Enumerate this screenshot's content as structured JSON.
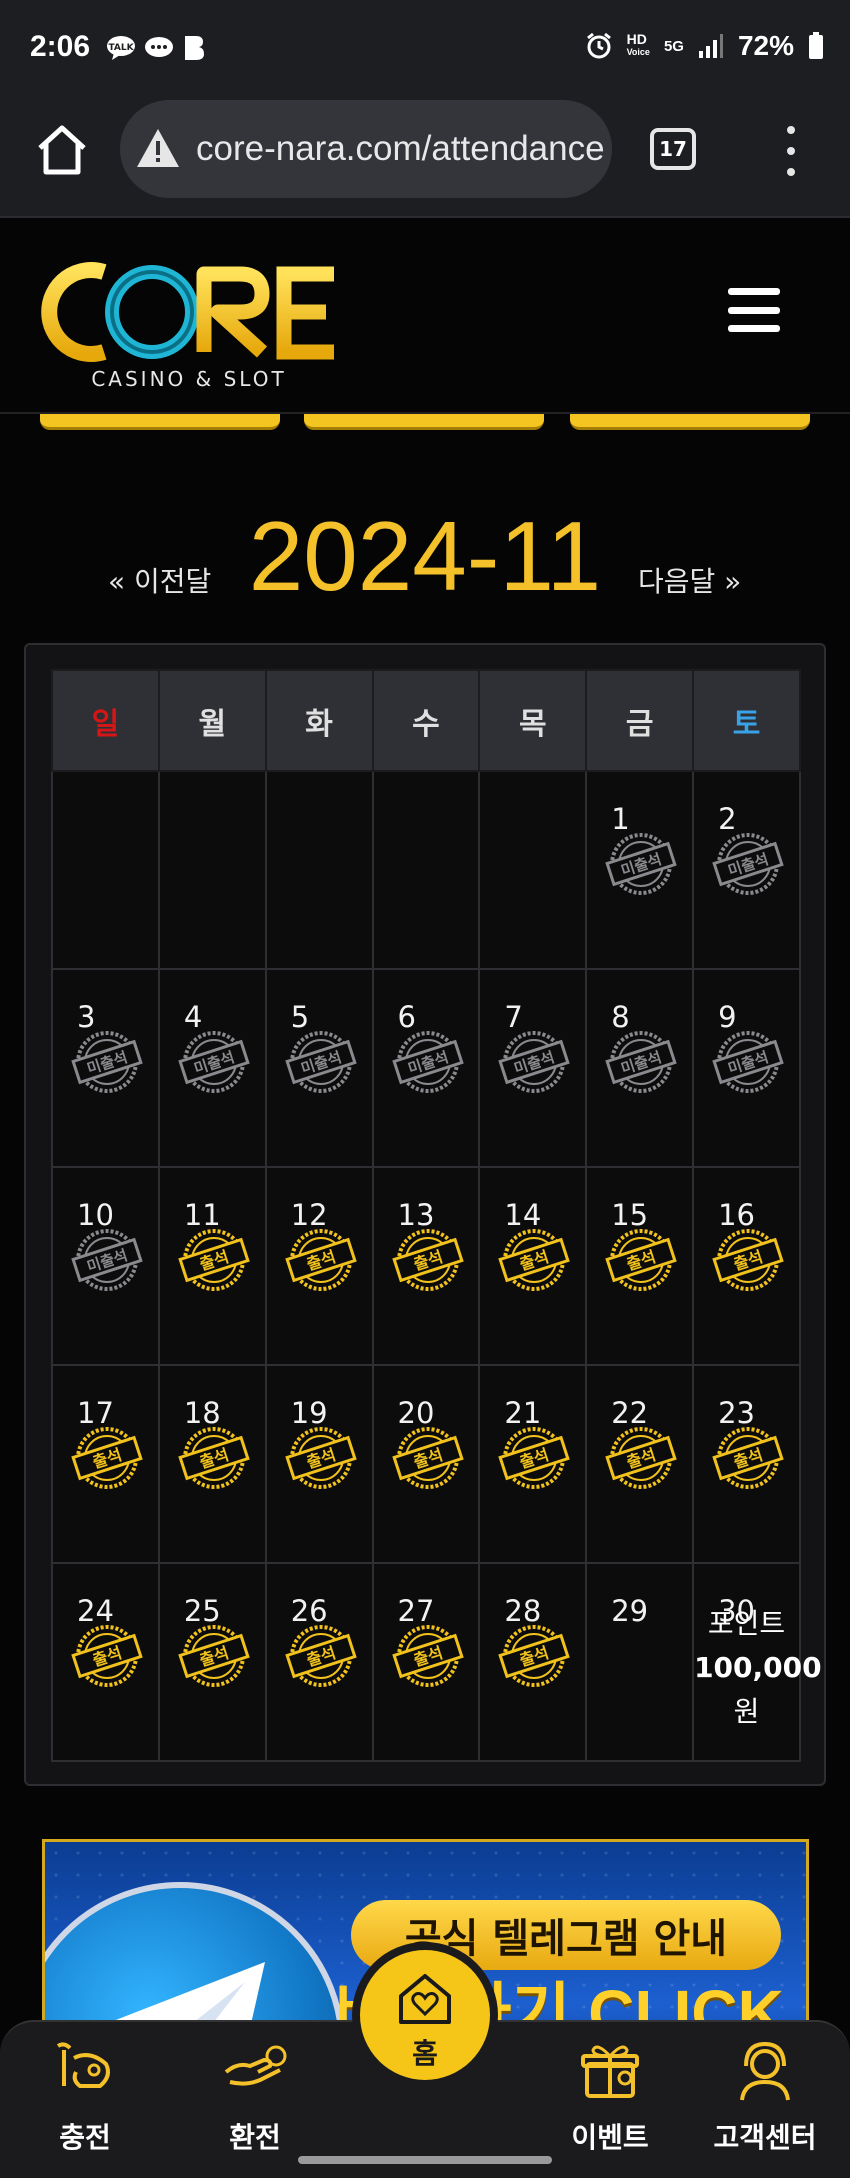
{
  "status_bar": {
    "time": "2:06",
    "icons": [
      "talk-icon",
      "chat-bubble-icon",
      "cloud-chat-icon",
      "b-app-icon",
      "alarm-icon",
      "hd-voice-icon",
      "5g-icon",
      "signal-icon"
    ],
    "hd_label": "HD",
    "voice_label": "Voice",
    "network": "5G",
    "battery": "72%"
  },
  "browser": {
    "url": "core-nara.com/attendance",
    "tab_count": "17"
  },
  "site": {
    "logo_text": "CORE",
    "logo_subtitle": "CASINO & SLOT"
  },
  "calendar": {
    "prev_label": "« 이전달",
    "next_label": "다음달 »",
    "month": "2024-11",
    "weekdays": [
      "일",
      "월",
      "화",
      "수",
      "목",
      "금",
      "토"
    ],
    "stamp_absent": "미출석",
    "stamp_present": "출석",
    "weeks": [
      [
        null,
        null,
        null,
        null,
        null,
        {
          "day": "1",
          "status": "absent"
        },
        {
          "day": "2",
          "status": "absent"
        }
      ],
      [
        {
          "day": "3",
          "status": "absent"
        },
        {
          "day": "4",
          "status": "absent"
        },
        {
          "day": "5",
          "status": "absent"
        },
        {
          "day": "6",
          "status": "absent"
        },
        {
          "day": "7",
          "status": "absent"
        },
        {
          "day": "8",
          "status": "absent"
        },
        {
          "day": "9",
          "status": "absent"
        }
      ],
      [
        {
          "day": "10",
          "status": "absent"
        },
        {
          "day": "11",
          "status": "present"
        },
        {
          "day": "12",
          "status": "present"
        },
        {
          "day": "13",
          "status": "present"
        },
        {
          "day": "14",
          "status": "present"
        },
        {
          "day": "15",
          "status": "present"
        },
        {
          "day": "16",
          "status": "present"
        }
      ],
      [
        {
          "day": "17",
          "status": "present"
        },
        {
          "day": "18",
          "status": "present"
        },
        {
          "day": "19",
          "status": "present"
        },
        {
          "day": "20",
          "status": "present"
        },
        {
          "day": "21",
          "status": "present"
        },
        {
          "day": "22",
          "status": "present"
        },
        {
          "day": "23",
          "status": "present"
        }
      ],
      [
        {
          "day": "24",
          "status": "present"
        },
        {
          "day": "25",
          "status": "present"
        },
        {
          "day": "26",
          "status": "present"
        },
        {
          "day": "27",
          "status": "present"
        },
        {
          "day": "28",
          "status": "present"
        },
        {
          "day": "29",
          "status": "none"
        },
        {
          "day": "30",
          "status": "reward"
        }
      ]
    ],
    "reward": {
      "line1": "포인트",
      "line2": "100,000",
      "line3": "원"
    }
  },
  "banner": {
    "title": "공식 텔레그램 안내",
    "cta": "바로가기 CLICK"
  },
  "bottom_nav": {
    "items": [
      {
        "label": "충전",
        "icon": "charge-icon"
      },
      {
        "label": "환전",
        "icon": "exchange-icon"
      },
      {
        "label": "홈",
        "icon": "home-heart-icon"
      },
      {
        "label": "이벤트",
        "icon": "gift-icon"
      },
      {
        "label": "고객센터",
        "icon": "support-agent-icon"
      }
    ]
  },
  "colors": {
    "accent": "#f4c12a",
    "sunday": "#d41616",
    "saturday": "#3aa2e6",
    "background": "#050505",
    "cell": "#0c0c0d",
    "header_cell": "#2f3035"
  }
}
